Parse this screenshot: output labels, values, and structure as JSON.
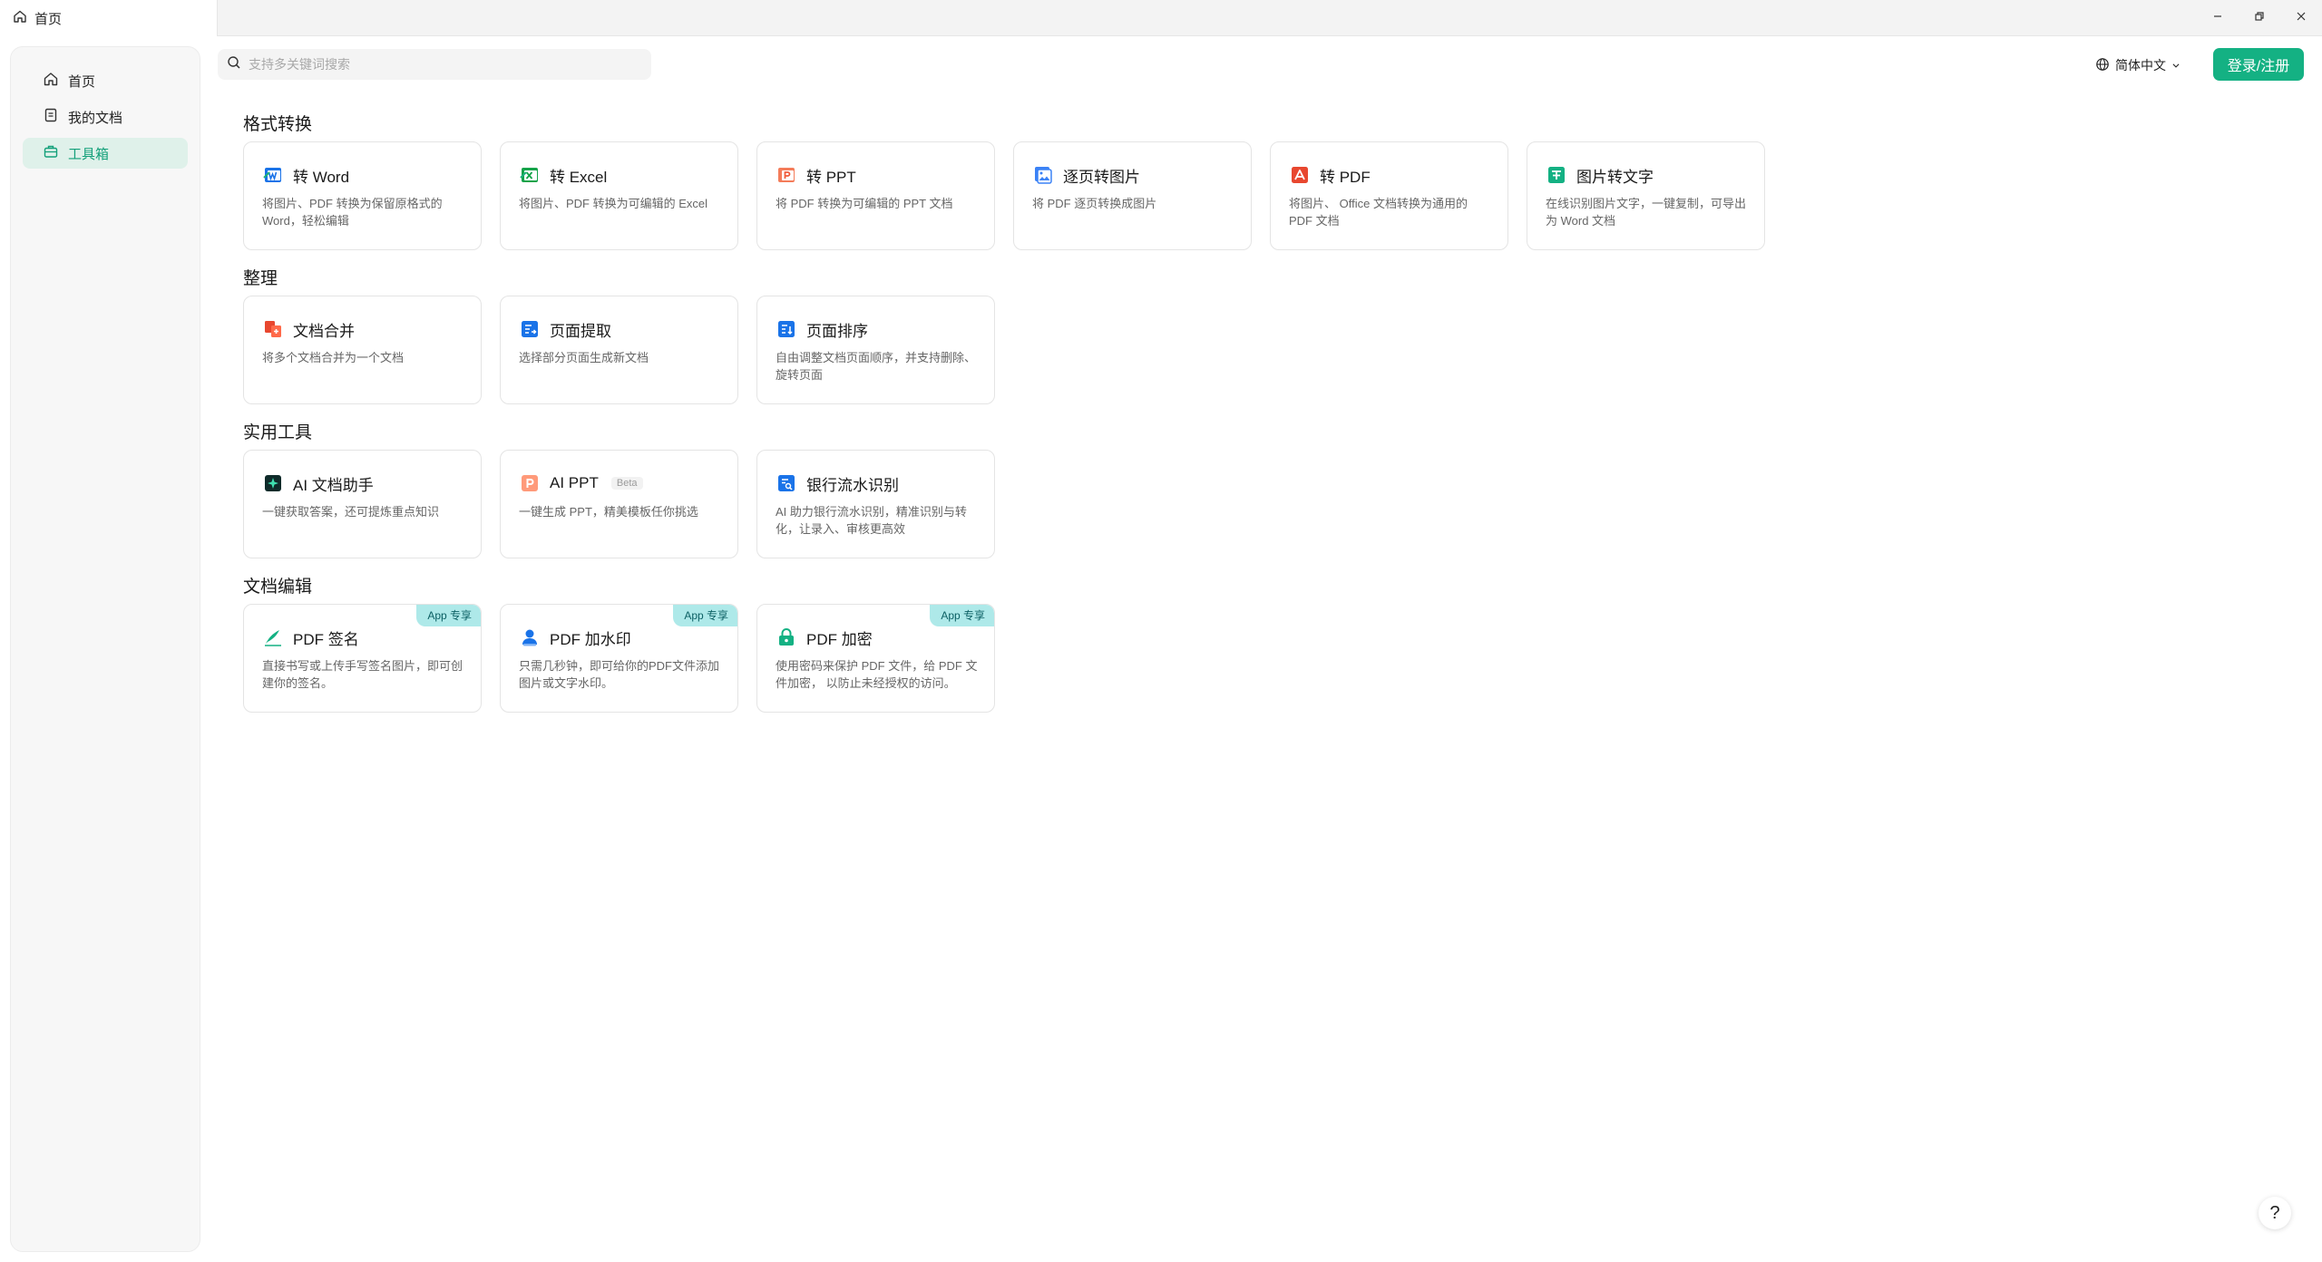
{
  "titlebar": {
    "tab_label": "首页",
    "tab_icon": "home-icon"
  },
  "sidebar": {
    "items": [
      {
        "label": "首页",
        "icon": "home-icon",
        "active": false
      },
      {
        "label": "我的文档",
        "icon": "document-icon",
        "active": false
      },
      {
        "label": "工具箱",
        "icon": "toolbox-icon",
        "active": true
      }
    ]
  },
  "search": {
    "placeholder": "支持多关键词搜索",
    "value": ""
  },
  "header": {
    "language": "简体中文",
    "login_label": "登录/注册"
  },
  "colors": {
    "accent": "#14b183",
    "active_bg": "#dff1ea",
    "badge_bg": "#aee9e9"
  },
  "sections": [
    {
      "title": "格式转换",
      "cards": [
        {
          "title": "转 Word",
          "desc": "将图片、PDF 转换为保留原格式的 Word，轻松编辑",
          "icon": "word-icon"
        },
        {
          "title": "转 Excel",
          "desc": "将图片、PDF 转换为可编辑的 Excel",
          "icon": "excel-icon"
        },
        {
          "title": "转 PPT",
          "desc": "将 PDF 转换为可编辑的 PPT 文档",
          "icon": "ppt-icon"
        },
        {
          "title": "逐页转图片",
          "desc": "将 PDF 逐页转换成图片",
          "icon": "image-icon"
        },
        {
          "title": "转 PDF",
          "desc": "将图片、 Office 文档转换为通用的 PDF 文档",
          "icon": "pdf-icon"
        },
        {
          "title": "图片转文字",
          "desc": "在线识别图片文字，一键复制，可导出为 Word 文档",
          "icon": "text-recognition-icon"
        }
      ]
    },
    {
      "title": "整理",
      "cards": [
        {
          "title": "文档合并",
          "desc": "将多个文档合并为一个文档",
          "icon": "merge-icon"
        },
        {
          "title": "页面提取",
          "desc": "选择部分页面生成新文档",
          "icon": "extract-icon"
        },
        {
          "title": "页面排序",
          "desc": "自由调整文档页面顺序，并支持删除、旋转页面",
          "icon": "sort-icon"
        }
      ]
    },
    {
      "title": "实用工具",
      "cards": [
        {
          "title": "AI 文档助手",
          "desc": "一键获取答案，还可提炼重点知识",
          "icon": "ai-assistant-icon"
        },
        {
          "title": "AI PPT",
          "badge_inline": "Beta",
          "desc": "一键生成 PPT，精美模板任你挑选",
          "icon": "ai-ppt-icon"
        },
        {
          "title": "银行流水识别",
          "desc": "AI 助力银行流水识别，精准识别与转化，让录入、审核更高效",
          "icon": "bank-statement-icon"
        }
      ]
    },
    {
      "title": "文档编辑",
      "cards": [
        {
          "title": "PDF 签名",
          "badge": "App 专享",
          "desc": "直接书写或上传手写签名图片，即可创建你的签名。",
          "icon": "signature-icon"
        },
        {
          "title": "PDF 加水印",
          "badge": "App 专享",
          "desc": "只需几秒钟，即可给你的PDF文件添加图片或文字水印。",
          "icon": "watermark-icon"
        },
        {
          "title": "PDF 加密",
          "badge": "App 专享",
          "desc": "使用密码来保护 PDF 文件，给 PDF 文件加密， 以防止未经授权的访问。",
          "icon": "lock-icon"
        }
      ]
    }
  ],
  "help_label": "?"
}
